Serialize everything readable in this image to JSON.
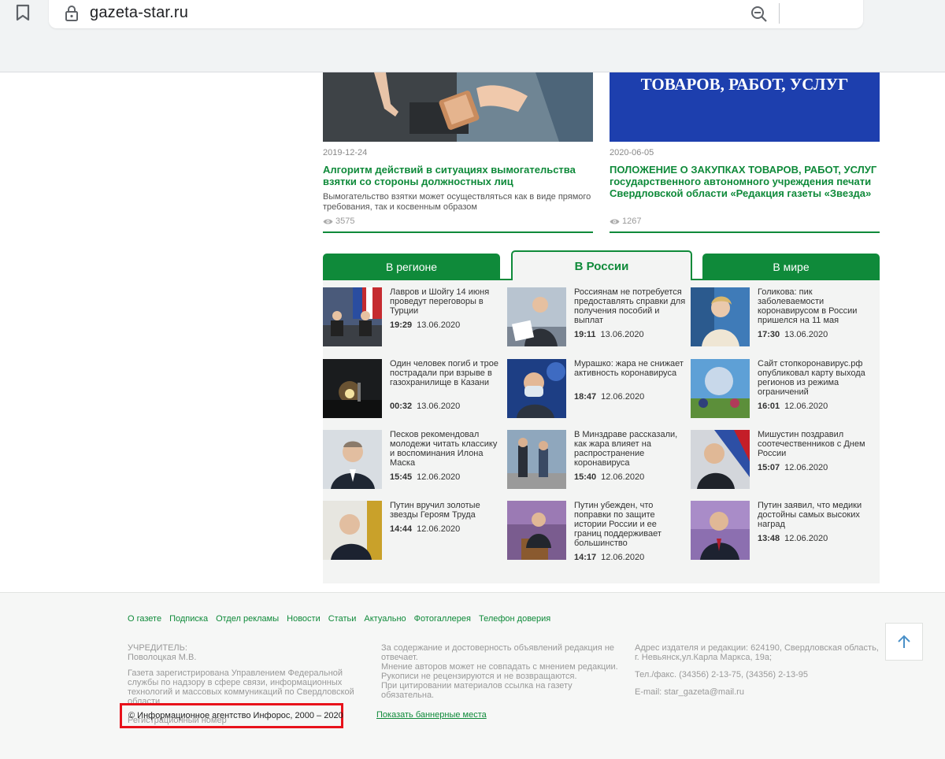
{
  "browser": {
    "url": "gazeta-star.ru"
  },
  "articles": [
    {
      "date": "2019-12-24",
      "title": "Алгоритм действий в ситуациях вымогательства взятки со стороны должностных лиц",
      "desc": "Вымогательство взятки может осуществляться как в виде прямого требования, так и косвенным образом",
      "views": "3575"
    },
    {
      "date": "2020-06-05",
      "title": "ПОЛОЖЕНИЕ О ЗАКУПКАХ ТОВАРОВ, РАБОТ, УСЛУГ государственного автономного учреждения печати Свердловской области «Редакция газеты «Звезда»",
      "image_text": "ТОВАРОВ, РАБОТ, УСЛУГ",
      "views": "1267"
    }
  ],
  "tabs": [
    {
      "label": "В регионе"
    },
    {
      "label": "В России"
    },
    {
      "label": "В мире"
    }
  ],
  "news": [
    {
      "title": "Лавров и Шойгу 14 июня проведут переговоры в Турции",
      "time": "19:29",
      "date": "13.06.2020"
    },
    {
      "title": "Россиянам не потребуется предоставлять справки для получения пособий и выплат",
      "time": "19:11",
      "date": "13.06.2020"
    },
    {
      "title": "Голикова: пик заболеваемости коронавирусом в России пришелся на 11 мая",
      "time": "17:30",
      "date": "13.06.2020"
    },
    {
      "title": "Один человек погиб и трое пострадали при взрыве в газохранилище в Казани",
      "time": "00:32",
      "date": "13.06.2020"
    },
    {
      "title": "Мурашко: жара не снижает активность коронавируса",
      "time": "18:47",
      "date": "12.06.2020"
    },
    {
      "title": "Сайт стопкоронавирус.рф опубликовал карту выхода регионов из режима ограничений",
      "time": "16:01",
      "date": "12.06.2020"
    },
    {
      "title": "Песков рекомендовал молодежи читать классику и воспоминания Илона Маска",
      "time": "15:45",
      "date": "12.06.2020"
    },
    {
      "title": "В Минздраве рассказали, как жара влияет на распространение коронавируса",
      "time": "15:40",
      "date": "12.06.2020"
    },
    {
      "title": "Мишустин поздравил соотечественников с Днем России",
      "time": "15:07",
      "date": "12.06.2020"
    },
    {
      "title": "Путин вручил золотые звезды Героям Труда",
      "time": "14:44",
      "date": "12.06.2020"
    },
    {
      "title": "Путин убежден, что поправки по защите истории России и ее границ поддерживает большинство",
      "time": "14:17",
      "date": "12.06.2020"
    },
    {
      "title": "Путин заявил, что медики достойны самых высоких наград",
      "time": "13:48",
      "date": "12.06.2020"
    }
  ],
  "footer": {
    "nav": [
      "О газете",
      "Подписка",
      "Отдел рекламы",
      "Новости",
      "Статьи",
      "Актуально",
      "Фотогаллерея",
      "Телефон доверия"
    ],
    "founder_label": "УЧРЕДИТЕЛЬ:",
    "founder_name": "Поволоцкая М.В.",
    "registration": "Газета зарегистрирована Управлением Федеральной службы по надзору в сфере связи, информационных технологий и массовых коммуникаций по Свердловской области",
    "reg_number": "Регистрационный номер",
    "disclaimer_1": "За содержание и достоверность объявлений редакция не отвечает.",
    "disclaimer_2": "Мнение авторов может не совпадать с мнением редакции.",
    "disclaimer_3": "Рукописи не рецензируются и не возвращаются.",
    "disclaimer_4": "При цитировании материалов ссылка на газету обязательна.",
    "address": "Адрес издателя и редакции: 624190, Свердловская область, г. Невьянск,ул.Карла Маркса, 19а;",
    "phone": "Тел./факс. (34356) 2-13-75, (34356) 2-13-95",
    "email": "E-mail: star_gazeta@mail.ru",
    "copyright": "© Информационное агентство Инфорос, 2000 – 2020",
    "banner_link": "Показать баннерные места"
  },
  "colors": {
    "accent_green": "#0f8a3a",
    "highlight_red": "#e8121b"
  }
}
